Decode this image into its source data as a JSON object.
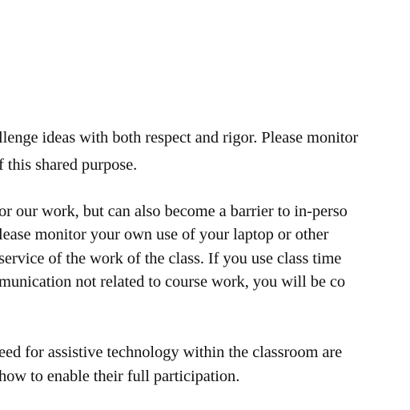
{
  "document": {
    "paragraph_1": [
      "llenge ideas with both respect and rigor. Please monitor",
      "f this shared purpose."
    ],
    "paragraph_2": [
      "or our work, but can also become a barrier to in-perso",
      "lease monitor your own use of your laptop or other",
      "service of the work of the class. If you use class time",
      "munication not related to course work, you will be co"
    ],
    "paragraph_3": [
      "eed for assistive technology within the classroom are",
      "how to enable their full participation."
    ]
  }
}
